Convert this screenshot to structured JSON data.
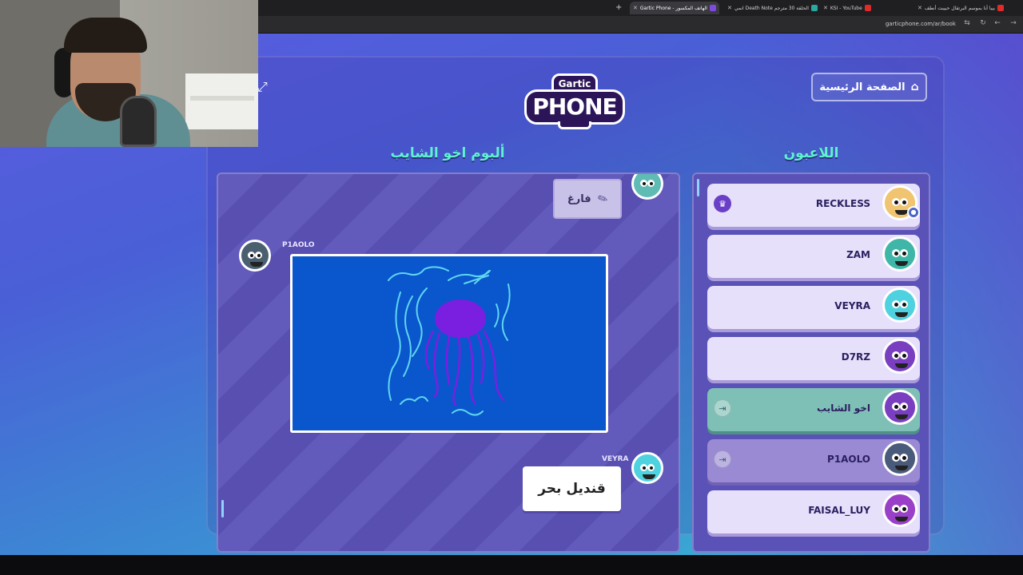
{
  "browser": {
    "tabs": [
      {
        "label": "Gartic Phone - الهاتف المكسور",
        "active": true,
        "color": "#7d4be0"
      },
      {
        "label": "انمي Death Note الحلقة 30 مترجم",
        "active": false,
        "color": "#2aa7a0"
      },
      {
        "label": "KSI - YouTube",
        "active": false,
        "color": "#e02b2b"
      },
      {
        "label": "بيبا أنا بموسم البرتقال حبيبت أنطف",
        "active": false,
        "color": "#e02b2b"
      }
    ],
    "url": "garticphone.com/ar/book"
  },
  "game": {
    "home_button_label": "الصفحة الرئيسية",
    "logo_top": "Gartic",
    "logo_main": "PHONE",
    "album_title": "ألبوم اخو الشايب",
    "players_title": "اللاعبون",
    "album": {
      "empty_card_label": "فارغ",
      "drawing_author": "P1AOLO",
      "guess_author": "VEYRA",
      "guess_text": "قنديل بحر"
    },
    "players": [
      {
        "name": "RECKLESS",
        "state": "owner",
        "avatar_color": "#f0c470"
      },
      {
        "name": "ZAM",
        "state": "normal",
        "avatar_color": "#3fb6a8"
      },
      {
        "name": "VEYRA",
        "state": "normal",
        "avatar_color": "#4fd2e0"
      },
      {
        "name": "D7RZ",
        "state": "normal",
        "avatar_color": "#7a3fc0"
      },
      {
        "name": "اخو الشايب",
        "state": "active",
        "avatar_color": "#7a3fc0"
      },
      {
        "name": "P1AOLO",
        "state": "dim",
        "avatar_color": "#4a5a7a"
      },
      {
        "name": "FAISAL_LUY",
        "state": "normal",
        "avatar_color": "#9a3fc8"
      }
    ]
  },
  "colors": {
    "accent_title": "#5ff2d0",
    "drawing_background": "#0a56cc",
    "jellyfish": "#7a1fe0",
    "sea_lines": "#5fd6f0"
  }
}
